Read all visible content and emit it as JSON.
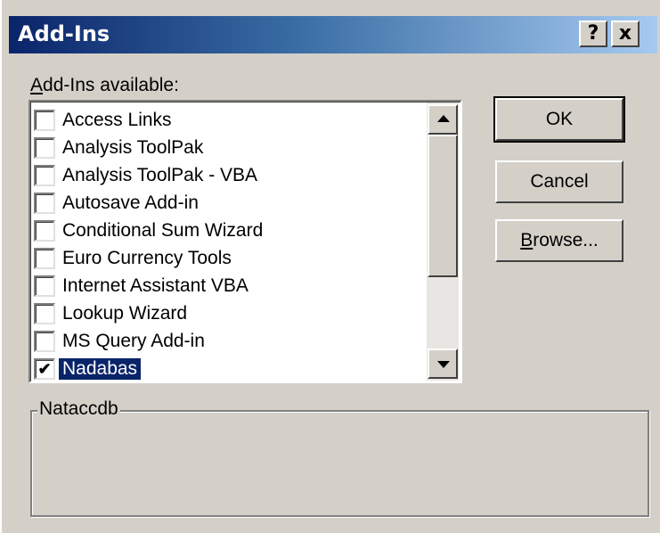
{
  "window": {
    "title": "Add-Ins",
    "help_glyph": "?",
    "close_glyph": "x"
  },
  "list": {
    "label_accel": "A",
    "label_rest": "dd-Ins available:",
    "items": [
      {
        "label": "Access Links",
        "checked": false
      },
      {
        "label": "Analysis ToolPak",
        "checked": false
      },
      {
        "label": "Analysis ToolPak - VBA",
        "checked": false
      },
      {
        "label": "Autosave Add-in",
        "checked": false
      },
      {
        "label": "Conditional Sum Wizard",
        "checked": false
      },
      {
        "label": "Euro Currency Tools",
        "checked": false
      },
      {
        "label": "Internet Assistant VBA",
        "checked": false
      },
      {
        "label": "Lookup Wizard",
        "checked": false
      },
      {
        "label": "MS Query Add-in",
        "checked": false
      },
      {
        "label": "Nadabas",
        "checked": true,
        "selected": true
      }
    ]
  },
  "buttons": {
    "ok": "OK",
    "cancel": "Cancel",
    "browse_accel": "B",
    "browse_rest": "rowse..."
  },
  "description": {
    "title": "Nataccdb"
  }
}
